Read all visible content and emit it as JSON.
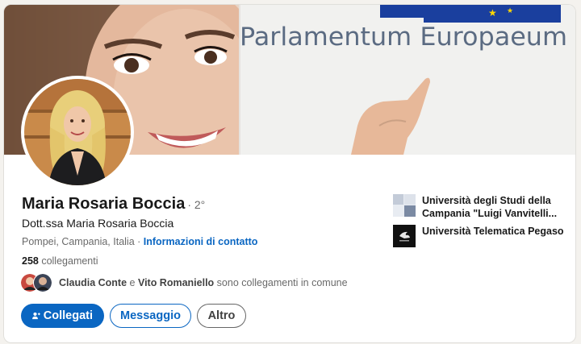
{
  "banner": {
    "sign_text": "Parlamentum Europaeum"
  },
  "profile": {
    "name": "Maria Rosaria Boccia",
    "degree": "· 2°",
    "headline": "Dott.ssa Maria Rosaria Boccia",
    "location": "Pompei, Campania, Italia",
    "separator": " · ",
    "contact_link": "Informazioni di contatto",
    "connections_count": "258",
    "connections_label": " collegamenti"
  },
  "mutual": {
    "person1": "Claudia Conte",
    "joiner": " e ",
    "person2": "Vito Romaniello",
    "suffix": " sono collegamenti in comune"
  },
  "actions": {
    "connect": "Collegati",
    "message": "Messaggio",
    "more": "Altro"
  },
  "education": [
    {
      "name": "Università degli Studi della Campania \"Luigi Vanvitelli...",
      "logo": "vanvitelli-logo"
    },
    {
      "name": "Università Telematica Pegaso",
      "logo": "pegaso-logo"
    }
  ],
  "colors": {
    "primary": "#0a66c2",
    "background": "#f4f2ee",
    "eu_blue": "#1a3f9e",
    "eu_star": "#ffd700"
  }
}
